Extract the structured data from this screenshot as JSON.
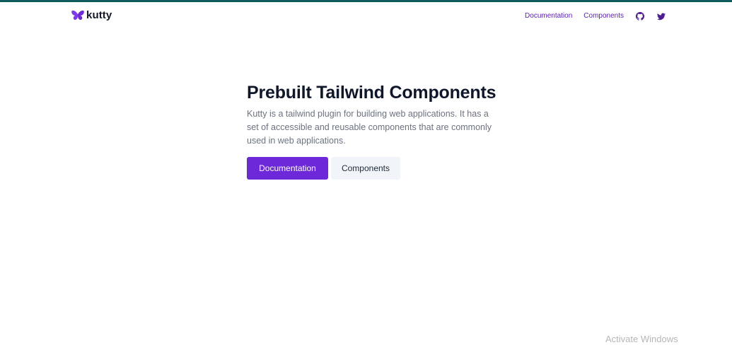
{
  "brand": {
    "name": "kutty",
    "logo_icon": "butterfly-icon",
    "logo_color": "#7c3aed"
  },
  "nav": {
    "documentation_label": "Documentation",
    "components_label": "Components",
    "github_icon": "github-icon",
    "twitter_icon": "twitter-icon"
  },
  "hero": {
    "title": "Prebuilt Tailwind Components",
    "description": "Kutty is a tailwind plugin for building web applications. It has a set of accessible and reusable components that are commonly used in web applications.",
    "primary_button": "Documentation",
    "secondary_button": "Components"
  },
  "os_watermark": {
    "text": "Activate Windows"
  },
  "colors": {
    "top_strip": "#0f5a5c",
    "accent": "#6d28d9",
    "link": "#5b21b6",
    "secondary_button_bg": "#f1f5f9"
  }
}
